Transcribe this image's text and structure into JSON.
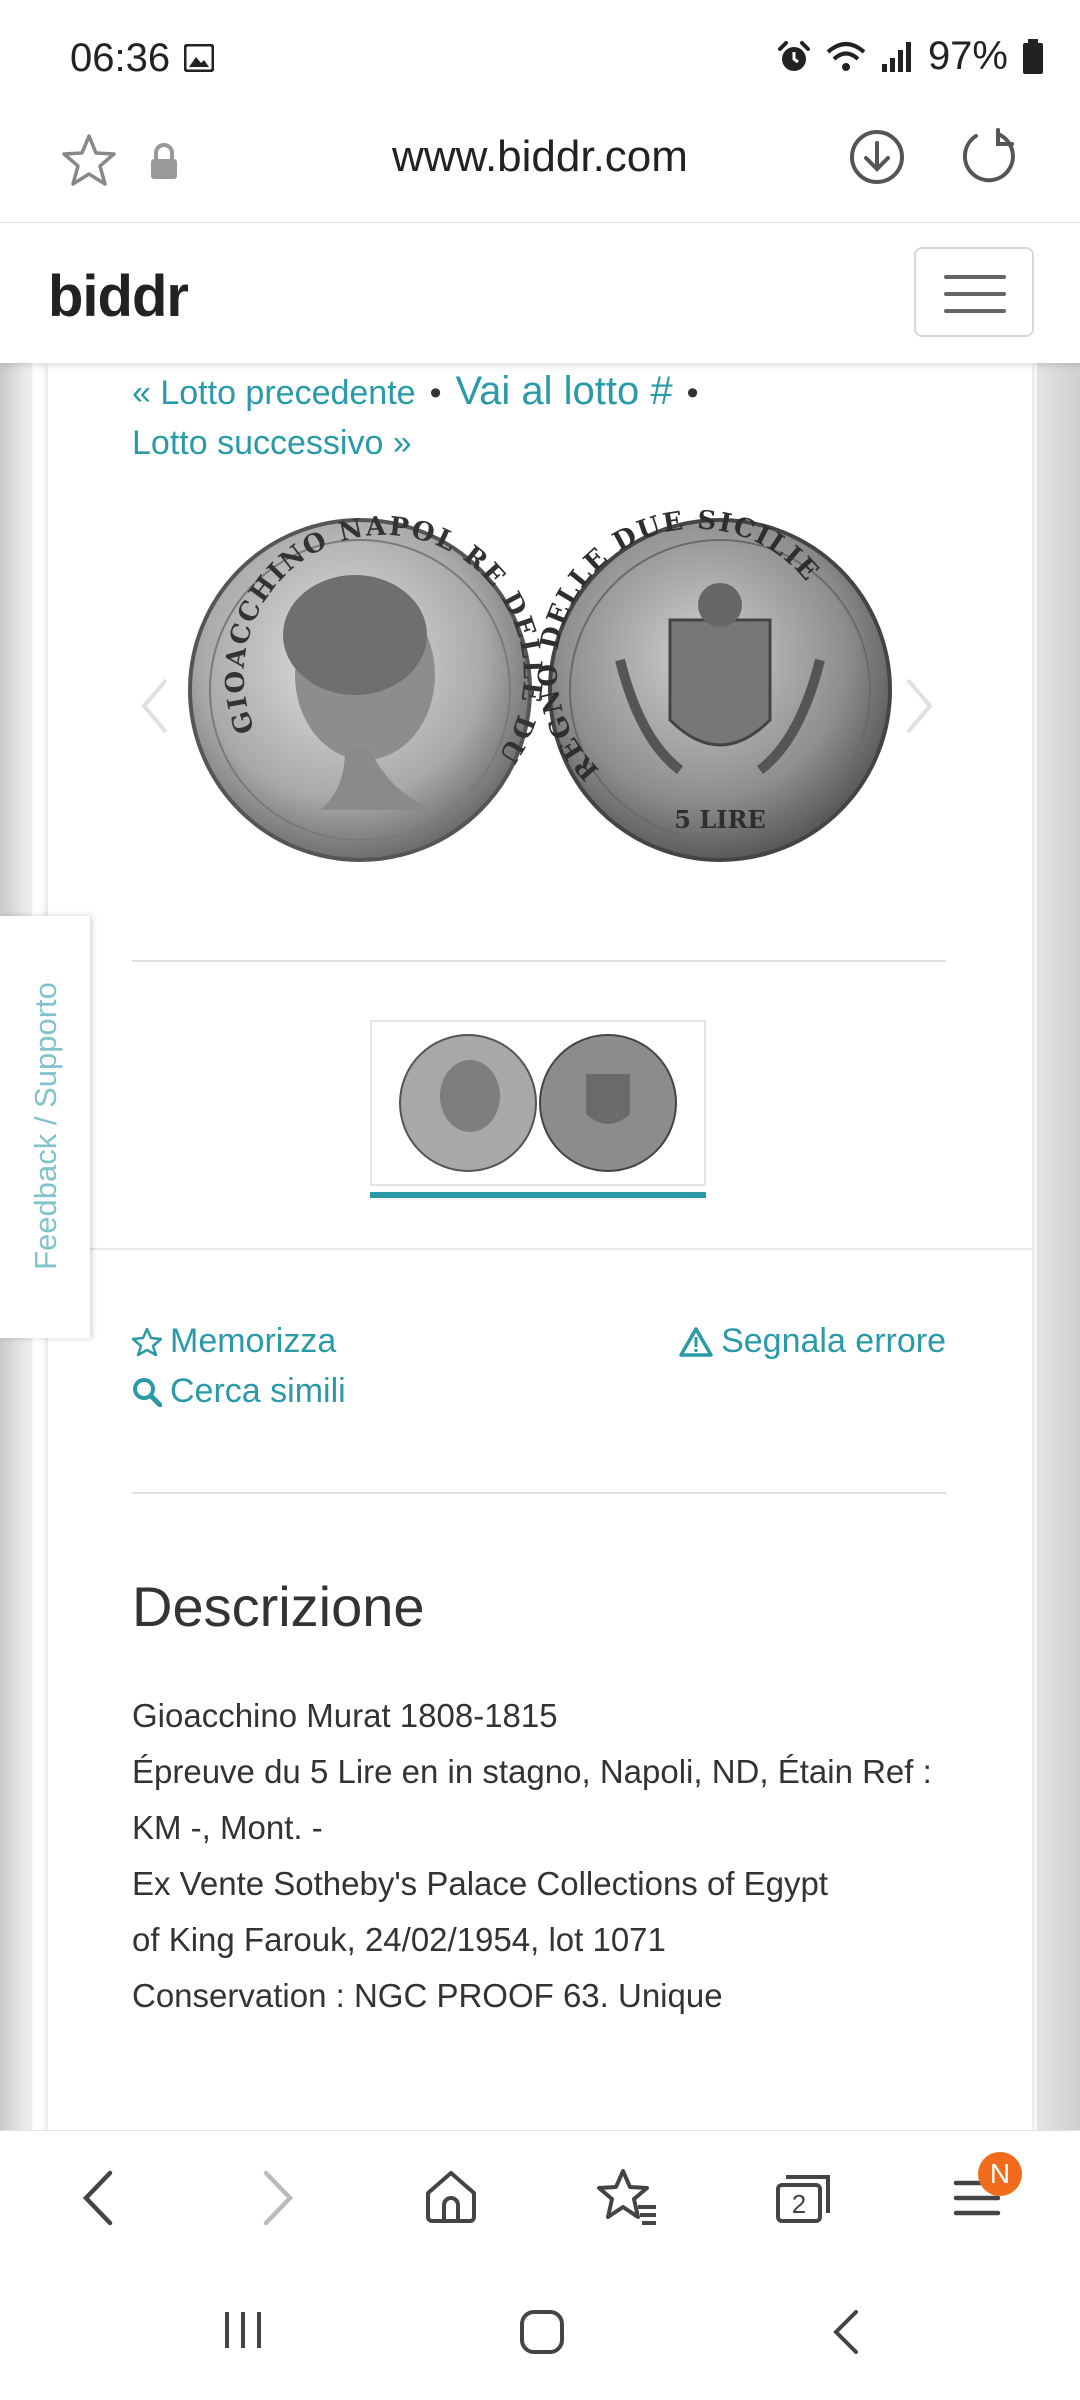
{
  "status_bar": {
    "time": "06:36",
    "battery": "97%"
  },
  "url_bar": {
    "url": "www.biddr.com"
  },
  "site_header": {
    "logo": "biddr"
  },
  "lot_nav": {
    "prev": "« Lotto precedente",
    "goto": "Vai al lotto #",
    "next": "Lotto successivo »"
  },
  "coin": {
    "obverse_legend": "GIOACCHINO NAPOL RE DELLE DUE SICIL",
    "reverse_legend": "REGNO DELLE DUE SICILIE",
    "denomination": "5 LIRE"
  },
  "feedback_tab": "Feedback / Supporto",
  "actions": {
    "save": "Memorizza",
    "report": "Segnala errore",
    "similar": "Cerca simili"
  },
  "description": {
    "title": "Descrizione",
    "lines": [
      "Gioacchino Murat 1808-1815",
      "Épreuve du 5 Lire en in stagno, Napoli, ND, Étain Ref :",
      "KM -, Mont. -",
      "Ex Vente Sotheby's Palace Collections of Egypt",
      "of King Farouk, 24/02/1954, lot 1071",
      "Conservation : NGC PROOF 63. Unique"
    ]
  },
  "browser_nav": {
    "tabs_count": "2",
    "menu_badge": "N"
  },
  "colors": {
    "accent": "#2a9aa8",
    "badge": "#f06b1b"
  }
}
